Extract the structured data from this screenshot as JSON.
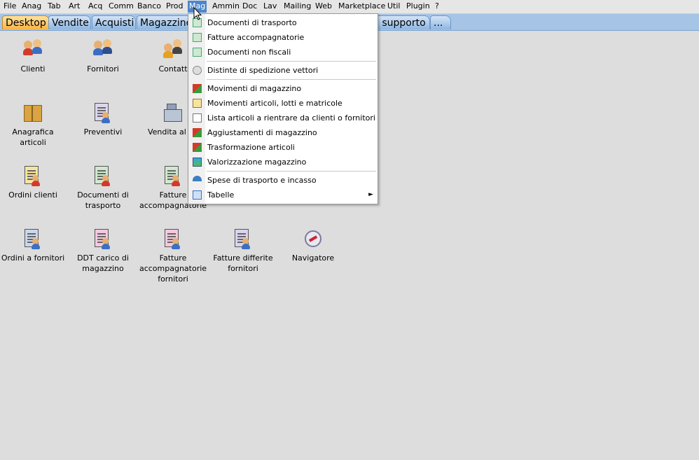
{
  "menubar": {
    "items": [
      {
        "label": "File"
      },
      {
        "label": "Anag"
      },
      {
        "label": "Tab"
      },
      {
        "label": "Art"
      },
      {
        "label": "Acq"
      },
      {
        "label": "Comm"
      },
      {
        "label": "Banco"
      },
      {
        "label": "Prod"
      },
      {
        "label": "Mag"
      },
      {
        "label": "Ammin"
      },
      {
        "label": "Doc"
      },
      {
        "label": "Lav"
      },
      {
        "label": "Mailing"
      },
      {
        "label": "Web"
      },
      {
        "label": "Marketplace"
      },
      {
        "label": "Util"
      },
      {
        "label": "Plugin"
      },
      {
        "label": "?"
      }
    ],
    "active": "Mag"
  },
  "tabs": [
    {
      "label": "Desktop"
    },
    {
      "label": "Vendite"
    },
    {
      "label": "Acquisti"
    },
    {
      "label": "Magazzino"
    },
    {
      "label": "i supporto"
    },
    {
      "label": "..."
    }
  ],
  "desktop": {
    "items": [
      {
        "label": "Clienti",
        "icon": "people-icon"
      },
      {
        "label": "Fornitori",
        "icon": "supplier-people-icon"
      },
      {
        "label": "Contatt",
        "icon": "contacts-icon"
      },
      {
        "label": "Anagrafica articoli",
        "icon": "box-icon"
      },
      {
        "label": "Preventivi",
        "icon": "quote-document-icon"
      },
      {
        "label": "Vendita al ba",
        "icon": "cash-register-icon"
      },
      {
        "label": "Ordini clienti",
        "icon": "order-document-icon"
      },
      {
        "label": "Documenti di trasporto",
        "icon": "transport-document-icon"
      },
      {
        "label": "Fatture accompagnatorie",
        "icon": "invoice-document-icon"
      },
      {
        "label": "Ordini a fornitori",
        "icon": "supplier-order-icon"
      },
      {
        "label": "DDT carico di magazzino",
        "icon": "ddt-document-icon"
      },
      {
        "label": "Fatture accompagnatorie fornitori",
        "icon": "supplier-invoice-icon"
      },
      {
        "label": "Fatture differite fornitori",
        "icon": "deferred-invoice-icon"
      },
      {
        "label": "Navigatore",
        "icon": "compass-icon"
      }
    ]
  },
  "dropdown": {
    "items": [
      {
        "label": "Documenti di trasporto"
      },
      {
        "label": "Fatture accompagnatorie"
      },
      {
        "label": "Documenti non fiscali"
      },
      {
        "label": "Distinte di spedizione vettori"
      },
      {
        "label": "Movimenti di magazzino"
      },
      {
        "label": "Movimenti articoli, lotti e matricole"
      },
      {
        "label": "Lista articoli a rientrare da clienti o fornitori"
      },
      {
        "label": "Aggiustamenti di magazzino"
      },
      {
        "label": "Trasformazione articoli"
      },
      {
        "label": "Valorizzazione magazzino"
      },
      {
        "label": "Spese di trasporto e incasso"
      },
      {
        "label": "Tabelle"
      }
    ],
    "submenu_arrow": "►"
  },
  "colors": {
    "menu_active": "#4f86cb",
    "tab_active": "#f7b443",
    "tab_bar": "#a5c4e6",
    "desktop_bg": "#dddddd"
  }
}
